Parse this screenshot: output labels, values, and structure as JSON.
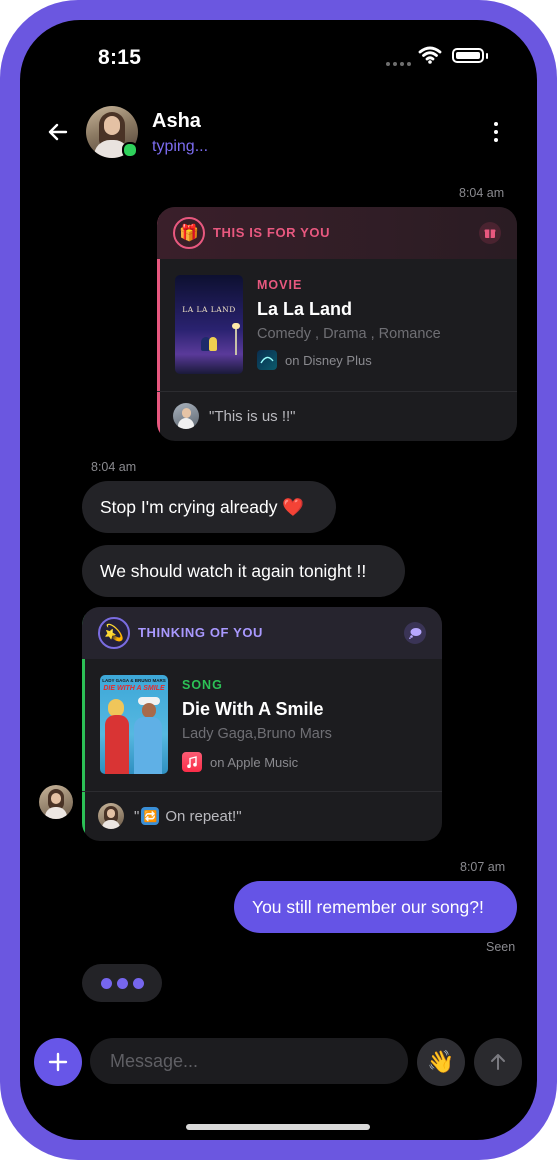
{
  "status_bar": {
    "time": "8:15"
  },
  "header": {
    "name": "Asha",
    "status": "typing..."
  },
  "messages": {
    "ts1": "8:04 am",
    "ts2": "8:04 am",
    "ts3": "8:07 am",
    "card1": {
      "title": "THIS IS FOR YOU",
      "kind": "MOVIE",
      "media_title": "La La Land",
      "genres": "Comedy , Drama , Romance",
      "provider": "on Disney Plus",
      "poster_text": "LA LA LAND",
      "note": "\"This is us !!\""
    },
    "bubble1": "Stop I'm crying already ❤️",
    "bubble2": "We should watch it again tonight !!",
    "card2": {
      "title": "THINKING OF YOU",
      "kind": "SONG",
      "media_title": "Die With A Smile",
      "artists": "Lady Gaga,Bruno Mars",
      "provider": "on Apple Music",
      "poster_top": "LADY GAGA & BRUNO MARS",
      "poster_text": "DIE WITH A SMILE",
      "note_emoji": "🔁",
      "note_text": "On repeat!\""
    },
    "bubble3": "You still remember our song?!",
    "seen": "Seen"
  },
  "composer": {
    "placeholder": "Message..."
  },
  "colors": {
    "accent": "#6554e6",
    "frame": "#6b57e0",
    "gift_pink": "#e8587f",
    "song_green": "#2cc156",
    "card2_purple": "#a999ff"
  }
}
